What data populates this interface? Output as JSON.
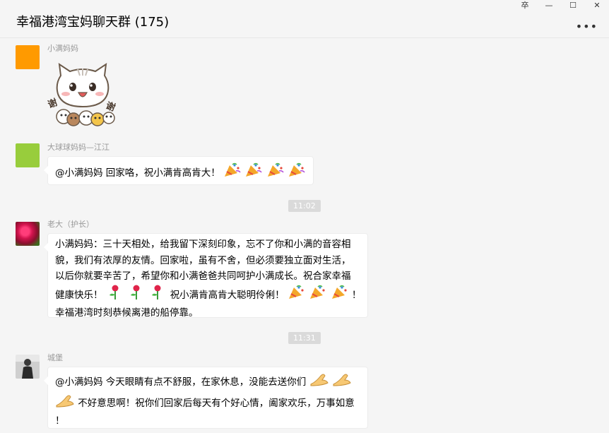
{
  "window": {
    "title": "幸福港湾宝妈聊天群 (175)",
    "controls": {
      "pin": "卒",
      "minimize": "—",
      "maximize": "☐",
      "close": "✕"
    },
    "more": "•••"
  },
  "colors": {
    "bubble": "#ffffff",
    "background": "#f5f5f5",
    "timestamp_bg": "#dadada",
    "avatar_orange": "#ff9a00",
    "avatar_green": "#98cd3c"
  },
  "messages": [
    {
      "sender": "小满妈妈",
      "avatar": "orange-square",
      "type": "sticker",
      "sticker": "thank-you-cat-sticker",
      "sticker_text": [
        "谢",
        "谢"
      ]
    },
    {
      "sender": "大球球妈妈—江江",
      "avatar": "green-square",
      "type": "text",
      "text": "@小满妈妈 回家咯，祝小满肯高肯大！"
    },
    {
      "type": "time",
      "text": "11:02"
    },
    {
      "sender": "老大（护长）",
      "avatar": "flower-photo",
      "type": "text",
      "lines": [
        "小满妈妈：三十天相处，给我留下深刻印象，忘不了你和小满的音容相",
        "貌，我们有浓厚的友情。回家啦，虽有不舍，但必须要独立面对生活，",
        "以后你就要辛苦了，希望你和小满爸爸共同呵护小满成长。祝合家幸福",
        "健康快乐！",
        "祝小满肯高肯大聪明伶俐！",
        "！",
        "幸福港湾时刻恭候离港的船停靠。"
      ]
    },
    {
      "type": "time",
      "text": "11:31"
    },
    {
      "sender": "城堡",
      "avatar": "person-photo",
      "type": "text",
      "lines": [
        "@小满妈妈 今天眼睛有点不舒服，在家休息，没能去送你们",
        "不好意思啊！祝你们回家后每天有个好心情，阖家欢乐，万事如意",
        "！"
      ]
    }
  ]
}
